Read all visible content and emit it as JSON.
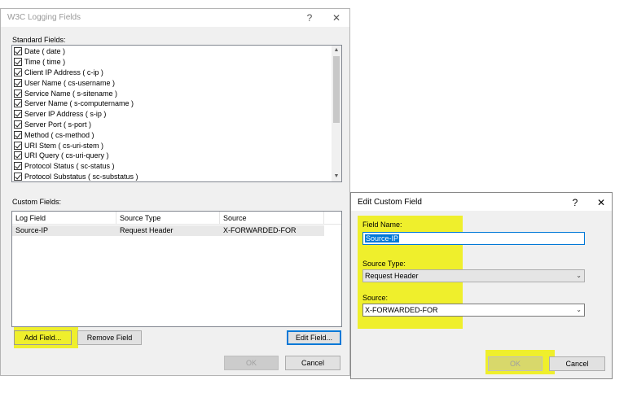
{
  "main_dialog": {
    "title": "W3C Logging Fields",
    "help_glyph": "?",
    "close_glyph": "✕",
    "standard_fields_label": "Standard Fields:",
    "standard_fields": [
      "Date ( date )",
      "Time ( time )",
      "Client IP Address ( c-ip )",
      "User Name ( cs-username )",
      "Service Name ( s-sitename )",
      "Server Name ( s-computername )",
      "Server IP Address ( s-ip )",
      "Server Port ( s-port )",
      "Method ( cs-method )",
      "URI Stem ( cs-uri-stem )",
      "URI Query ( cs-uri-query )",
      "Protocol Status ( sc-status )",
      "Protocol Substatus ( sc-substatus )"
    ],
    "custom_fields_label": "Custom Fields:",
    "custom_columns": [
      "Log Field",
      "Source Type",
      "Source"
    ],
    "custom_rows": [
      {
        "log_field": "Source-IP",
        "source_type": "Request Header",
        "source": "X-FORWARDED-FOR"
      }
    ],
    "add_field": "Add Field...",
    "remove_field": "Remove Field",
    "edit_field": "Edit Field...",
    "ok": "OK",
    "cancel": "Cancel"
  },
  "edit_dialog": {
    "title": "Edit Custom Field",
    "help_glyph": "?",
    "close_glyph": "✕",
    "field_name_label": "Field Name:",
    "field_name_value": "Source-IP",
    "source_type_label": "Source Type:",
    "source_type_value": "Request Header",
    "source_label": "Source:",
    "source_value": "X-FORWARDED-FOR",
    "ok": "OK",
    "cancel": "Cancel"
  },
  "colors": {
    "highlight": "#eeee00",
    "focus_blue": "#0078d7",
    "selection_blue": "#0078d7"
  }
}
